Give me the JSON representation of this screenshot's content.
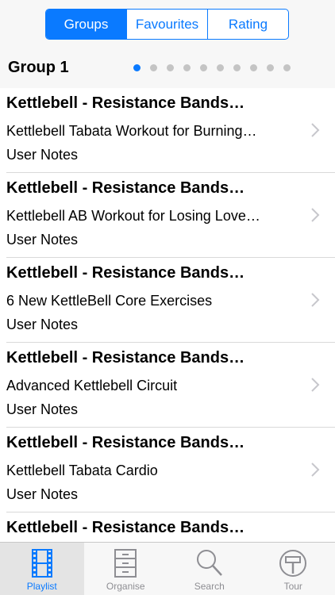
{
  "segments": [
    {
      "label": "Groups",
      "active": true
    },
    {
      "label": "Favourites",
      "active": false
    },
    {
      "label": "Rating",
      "active": false
    }
  ],
  "group": {
    "title": "Group 1",
    "page_count": 10,
    "current_page": 1
  },
  "items": [
    {
      "title": "Kettlebell - Resistance Bands…",
      "subtitle": "Kettlebell Tabata Workout for Burning…",
      "notes": "User Notes"
    },
    {
      "title": "Kettlebell - Resistance Bands…",
      "subtitle": "Kettlebell AB Workout for Losing Love…",
      "notes": "User Notes"
    },
    {
      "title": "Kettlebell - Resistance Bands…",
      "subtitle": "6 New KettleBell Core Exercises",
      "notes": "User Notes"
    },
    {
      "title": "Kettlebell - Resistance Bands…",
      "subtitle": "Advanced Kettlebell Circuit",
      "notes": "User Notes"
    },
    {
      "title": "Kettlebell - Resistance Bands…",
      "subtitle": "Kettlebell Tabata Cardio",
      "notes": "User Notes"
    },
    {
      "title": "Kettlebell - Resistance Bands…",
      "subtitle": "",
      "notes": ""
    }
  ],
  "tabs": [
    {
      "label": "Playlist",
      "icon": "film-strip-icon",
      "active": true
    },
    {
      "label": "Organise",
      "icon": "cabinet-icon",
      "active": false
    },
    {
      "label": "Search",
      "icon": "search-icon",
      "active": false
    },
    {
      "label": "Tour",
      "icon": "signpost-icon",
      "active": false
    }
  ],
  "colors": {
    "accent": "#0a7aff",
    "inactive": "#8e8e93",
    "separator": "#d9d9d9"
  }
}
